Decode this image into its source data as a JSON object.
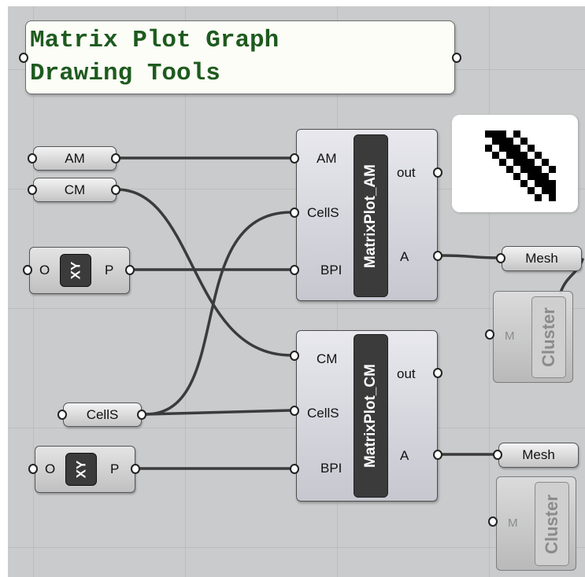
{
  "panel": {
    "lines": [
      "Matrix Plot Graph",
      "Drawing Tools"
    ]
  },
  "params": {
    "am": "AM",
    "cm": "CM",
    "cells": "CellS",
    "mesh_1": "Mesh",
    "mesh_2": "Mesh"
  },
  "xy_components": [
    {
      "in": "O",
      "badge": "XY",
      "out": "P"
    },
    {
      "in": "O",
      "badge": "XY",
      "out": "P"
    }
  ],
  "components": [
    {
      "name": "MatrixPlot_AM",
      "inputs": [
        "AM",
        "CellS",
        "BPI"
      ],
      "outputs": [
        "out",
        "A"
      ]
    },
    {
      "name": "MatrixPlot_CM",
      "inputs": [
        "CM",
        "CellS",
        "BPI"
      ],
      "outputs": [
        "out",
        "A"
      ]
    }
  ],
  "clusters": [
    {
      "name": "Cluster",
      "input": "M"
    },
    {
      "name": "Cluster",
      "input": "M"
    }
  ],
  "colors": {
    "canvas": "#c9cbcc",
    "panel_text": "#1e5a1e",
    "wire": "#3b3b3b"
  }
}
